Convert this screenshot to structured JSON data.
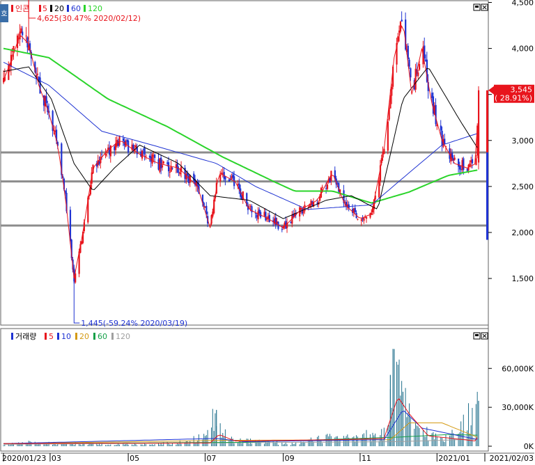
{
  "colors": {
    "up": "#e8141c",
    "down": "#1e32d2",
    "ma5": "#e8141c",
    "ma20": "#000000",
    "ma60": "#1e32d2",
    "ma120": "#2ad42a",
    "vol_ma5": "#e8141c",
    "vol_ma10": "#1e32d2",
    "vol_ma20": "#d49a14",
    "vol_ma60": "#14a048",
    "vol_ma120": "#a0a0a0",
    "support_line": "#8c8c8c",
    "frame": "#606060"
  },
  "header": {
    "period_badge": "호",
    "price_legend": [
      "인콘",
      "5",
      "20",
      "60",
      "120"
    ],
    "volume_legend": [
      "거래량",
      "5",
      "10",
      "20",
      "60",
      "120"
    ]
  },
  "annotations": {
    "high": "4,625(30.47% 2020/02/12)",
    "low": "1,445(-59.24% 2020/03/19)",
    "last_price": "3,545",
    "last_change": "( 28.91%)"
  },
  "chart_data": [
    {
      "type": "candlestick",
      "title": "",
      "series_name": "인콘",
      "ylim": [
        1250,
        4900
      ],
      "y_ticks": [
        "4,500",
        "4,000",
        "3,500",
        "3,000",
        "2,500",
        "2,000",
        "1,500"
      ],
      "y_tick_values": [
        4500,
        4000,
        3500,
        3000,
        2500,
        2000,
        1500
      ],
      "x_labels": [
        "2020/01/23",
        "03",
        "05",
        "07",
        "09",
        "11",
        "2021/01",
        "2021/02/03"
      ],
      "x_label_dates": [
        "2020-01-23",
        "2020-03-01",
        "2020-05-01",
        "2020-07-01",
        "2020-09-01",
        "2020-11-01",
        "2021-01-01",
        "2021-02-03"
      ],
      "horizontal_lines": [
        2870,
        2555,
        2075
      ],
      "price_keypoints": [
        {
          "date": "2020-01-23",
          "close": 3650
        },
        {
          "date": "2020-01-30",
          "close": 3900
        },
        {
          "date": "2020-02-05",
          "close": 4150
        },
        {
          "date": "2020-02-12",
          "close": 4050
        },
        {
          "date": "2020-02-20",
          "close": 3600
        },
        {
          "date": "2020-02-28",
          "close": 3300
        },
        {
          "date": "2020-03-06",
          "close": 2950
        },
        {
          "date": "2020-03-12",
          "close": 2400
        },
        {
          "date": "2020-03-19",
          "close": 1500
        },
        {
          "date": "2020-03-26",
          "close": 2000
        },
        {
          "date": "2020-04-03",
          "close": 2700
        },
        {
          "date": "2020-04-15",
          "close": 2900
        },
        {
          "date": "2020-04-25",
          "close": 3000
        },
        {
          "date": "2020-05-10",
          "close": 2850
        },
        {
          "date": "2020-05-25",
          "close": 2750
        },
        {
          "date": "2020-06-10",
          "close": 2700
        },
        {
          "date": "2020-06-25",
          "close": 2500
        },
        {
          "date": "2020-07-05",
          "close": 2050
        },
        {
          "date": "2020-07-12",
          "close": 2650
        },
        {
          "date": "2020-07-25",
          "close": 2550
        },
        {
          "date": "2020-08-05",
          "close": 2250
        },
        {
          "date": "2020-08-20",
          "close": 2150
        },
        {
          "date": "2020-09-01",
          "close": 2050
        },
        {
          "date": "2020-09-15",
          "close": 2250
        },
        {
          "date": "2020-09-28",
          "close": 2350
        },
        {
          "date": "2020-10-10",
          "close": 2650
        },
        {
          "date": "2020-10-20",
          "close": 2300
        },
        {
          "date": "2020-11-01",
          "close": 2150
        },
        {
          "date": "2020-11-10",
          "close": 2200
        },
        {
          "date": "2020-11-20",
          "close": 2900
        },
        {
          "date": "2020-11-28",
          "close": 3900
        },
        {
          "date": "2020-12-05",
          "close": 4300
        },
        {
          "date": "2020-12-12",
          "close": 3500
        },
        {
          "date": "2020-12-20",
          "close": 4000
        },
        {
          "date": "2020-12-28",
          "close": 3400
        },
        {
          "date": "2021-01-05",
          "close": 3000
        },
        {
          "date": "2021-01-15",
          "close": 2750
        },
        {
          "date": "2021-01-25",
          "close": 2700
        },
        {
          "date": "2021-02-01",
          "close": 2750
        },
        {
          "date": "2021-02-03",
          "close": 3545
        }
      ],
      "ma_keypoints": {
        "ma20": [
          {
            "date": "2020-01-23",
            "value": 3750
          },
          {
            "date": "2020-02-12",
            "value": 3800
          },
          {
            "date": "2020-03-01",
            "value": 3450
          },
          {
            "date": "2020-03-19",
            "value": 2750
          },
          {
            "date": "2020-04-03",
            "value": 2450
          },
          {
            "date": "2020-04-20",
            "value": 2700
          },
          {
            "date": "2020-05-10",
            "value": 2950
          },
          {
            "date": "2020-06-10",
            "value": 2750
          },
          {
            "date": "2020-07-05",
            "value": 2400
          },
          {
            "date": "2020-08-05",
            "value": 2350
          },
          {
            "date": "2020-09-01",
            "value": 2150
          },
          {
            "date": "2020-10-05",
            "value": 2350
          },
          {
            "date": "2020-10-25",
            "value": 2400
          },
          {
            "date": "2020-11-15",
            "value": 2250
          },
          {
            "date": "2020-12-05",
            "value": 3450
          },
          {
            "date": "2020-12-25",
            "value": 3800
          },
          {
            "date": "2021-01-20",
            "value": 3200
          },
          {
            "date": "2021-02-03",
            "value": 2900
          }
        ],
        "ma60": [
          {
            "date": "2020-01-23",
            "value": 3850
          },
          {
            "date": "2020-02-28",
            "value": 3600
          },
          {
            "date": "2020-04-10",
            "value": 3100
          },
          {
            "date": "2020-05-20",
            "value": 2950
          },
          {
            "date": "2020-07-10",
            "value": 2750
          },
          {
            "date": "2020-08-10",
            "value": 2500
          },
          {
            "date": "2020-09-20",
            "value": 2250
          },
          {
            "date": "2020-11-10",
            "value": 2300
          },
          {
            "date": "2020-12-10",
            "value": 2650
          },
          {
            "date": "2021-01-05",
            "value": 2950
          },
          {
            "date": "2021-02-03",
            "value": 3080
          }
        ],
        "ma120": [
          {
            "date": "2020-01-23",
            "value": 4000
          },
          {
            "date": "2020-02-28",
            "value": 3900
          },
          {
            "date": "2020-04-15",
            "value": 3450
          },
          {
            "date": "2020-06-01",
            "value": 3150
          },
          {
            "date": "2020-07-15",
            "value": 2820
          },
          {
            "date": "2020-08-25",
            "value": 2550
          },
          {
            "date": "2020-09-10",
            "value": 2450
          },
          {
            "date": "2020-10-10",
            "value": 2450
          },
          {
            "date": "2020-11-10",
            "value": 2320
          },
          {
            "date": "2020-12-10",
            "value": 2440
          },
          {
            "date": "2021-01-10",
            "value": 2620
          },
          {
            "date": "2021-02-03",
            "value": 2680
          }
        ]
      },
      "high_point": {
        "date": "2020-02-12",
        "value": 4625
      },
      "low_point": {
        "date": "2020-03-19",
        "value": 1445
      }
    },
    {
      "type": "bar",
      "title": "",
      "series_name": "거래량",
      "ylim": [
        0,
        80000
      ],
      "y_ticks": [
        "60,000K",
        "30,000K",
        "0K"
      ],
      "y_tick_values": [
        60000,
        30000,
        0
      ],
      "volume_keypoints": [
        {
          "date": "2020-01-23",
          "value": 2000
        },
        {
          "date": "2020-02-12",
          "value": 3500
        },
        {
          "date": "2020-03-19",
          "value": 2500
        },
        {
          "date": "2020-05-05",
          "value": 1500
        },
        {
          "date": "2020-06-20",
          "value": 4000
        },
        {
          "date": "2020-07-10",
          "value": 28000
        },
        {
          "date": "2020-07-20",
          "value": 6000
        },
        {
          "date": "2020-09-10",
          "value": 2500
        },
        {
          "date": "2020-10-10",
          "value": 9000
        },
        {
          "date": "2020-10-15",
          "value": 6000
        },
        {
          "date": "2020-11-20",
          "value": 12000
        },
        {
          "date": "2020-11-25",
          "value": 38000
        },
        {
          "date": "2020-11-28",
          "value": 75000
        },
        {
          "date": "2020-12-05",
          "value": 42000
        },
        {
          "date": "2020-12-15",
          "value": 18000
        },
        {
          "date": "2021-01-05",
          "value": 6000
        },
        {
          "date": "2021-02-03",
          "value": 35000
        }
      ],
      "vol_ma_keypoints": {
        "ma5": [
          {
            "date": "2020-01-23",
            "value": 2000
          },
          {
            "date": "2020-07-05",
            "value": 2500
          },
          {
            "date": "2020-07-12",
            "value": 9000
          },
          {
            "date": "2020-07-25",
            "value": 4000
          },
          {
            "date": "2020-10-12",
            "value": 5000
          },
          {
            "date": "2020-11-20",
            "value": 6000
          },
          {
            "date": "2020-12-01",
            "value": 38000
          },
          {
            "date": "2020-12-10",
            "value": 25000
          },
          {
            "date": "2020-12-25",
            "value": 8000
          },
          {
            "date": "2021-02-01",
            "value": 4000
          },
          {
            "date": "2021-02-03",
            "value": 9000
          }
        ],
        "ma10": [
          {
            "date": "2020-01-23",
            "value": 2000
          },
          {
            "date": "2020-07-10",
            "value": 6000
          },
          {
            "date": "2020-08-01",
            "value": 3500
          },
          {
            "date": "2020-11-20",
            "value": 5000
          },
          {
            "date": "2020-12-05",
            "value": 28000
          },
          {
            "date": "2020-12-20",
            "value": 14000
          },
          {
            "date": "2021-02-03",
            "value": 5000
          }
        ],
        "ma20": [
          {
            "date": "2020-01-23",
            "value": 2000
          },
          {
            "date": "2020-07-15",
            "value": 4500
          },
          {
            "date": "2020-11-25",
            "value": 5000
          },
          {
            "date": "2020-12-10",
            "value": 18000
          },
          {
            "date": "2021-01-05",
            "value": 18000
          },
          {
            "date": "2021-02-03",
            "value": 6500
          }
        ],
        "ma60": [
          {
            "date": "2020-01-23",
            "value": 2000
          },
          {
            "date": "2020-08-01",
            "value": 3000
          },
          {
            "date": "2020-12-01",
            "value": 7000
          },
          {
            "date": "2021-01-10",
            "value": 9000
          },
          {
            "date": "2021-02-03",
            "value": 8500
          }
        ],
        "ma120": [
          {
            "date": "2020-01-23",
            "value": 1500
          },
          {
            "date": "2020-12-01",
            "value": 3500
          },
          {
            "date": "2021-02-03",
            "value": 5500
          }
        ]
      }
    }
  ]
}
